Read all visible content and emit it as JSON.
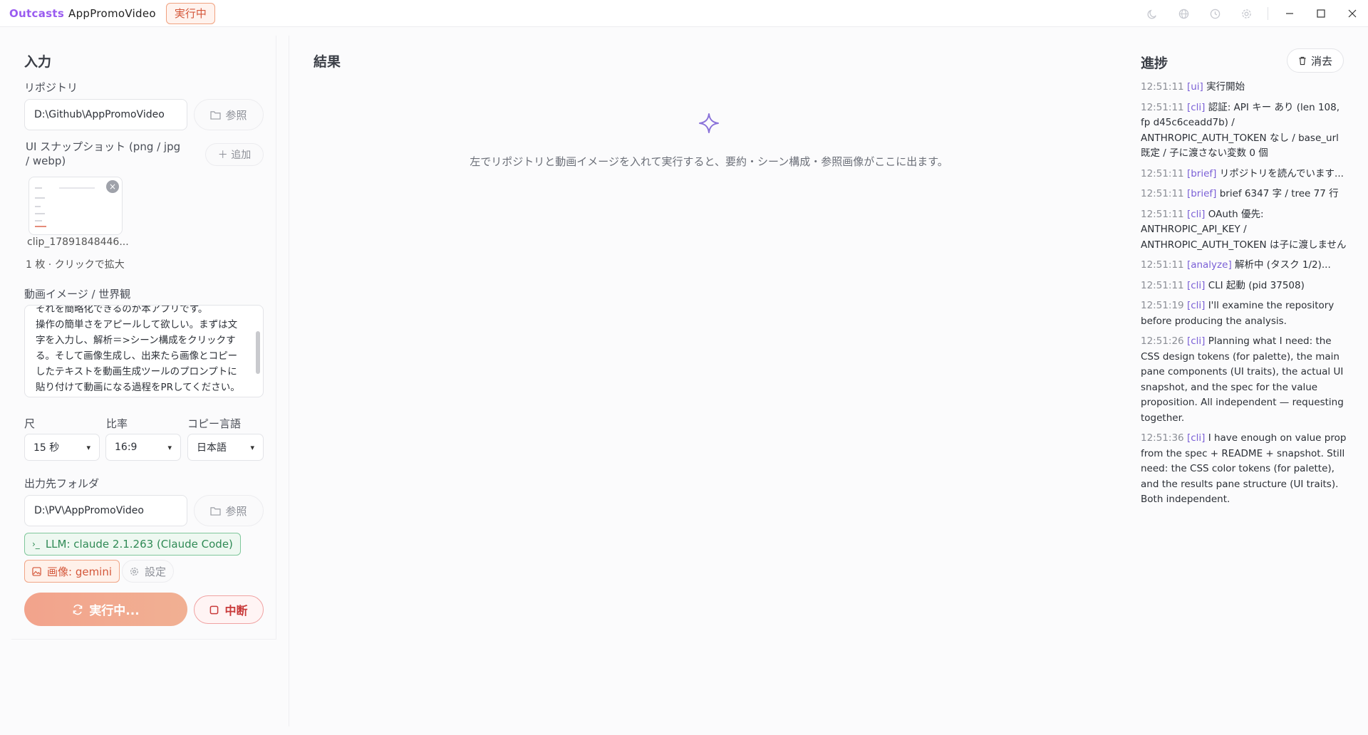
{
  "titlebar": {
    "brand": "Outcasts",
    "app_name": "AppPromoVideo",
    "status_badge": "実行中"
  },
  "input_panel": {
    "title": "入力",
    "repo_label": "リポジトリ",
    "repo_value": "D:\\Github\\AppPromoVideo",
    "browse_label": "参照",
    "snapshot_label": "UI スナップショット (png / jpg / webp)",
    "add_label": "＋ 追加",
    "snapshot_filename": "clip_17891848446...",
    "snapshot_caption": "1 枚 · クリックで拡大",
    "image_label": "動画イメージ / 世界観",
    "image_text_lines": [
      "それを簡略化できるのが本アプリです。",
      "操作の簡単さをアピールして欲しい。まずは文",
      "字を入力し、解析＝>シーン構成をクリックす",
      "る。そして画像生成し、出来たら画像とコピー",
      "したテキストを動画生成ツールのプロンプトに",
      "貼り付けて動画になる過程をPRしてください。"
    ],
    "length_label": "尺",
    "length_value": "15 秒",
    "ratio_label": "比率",
    "ratio_value": "16:9",
    "copy_lang_label": "コピー言語",
    "copy_lang_value": "日本語",
    "output_label": "出力先フォルダ",
    "output_value": "D:\\PV\\AppPromoVideo",
    "output_browse_label": "参照",
    "llm_badge": "LLM: claude 2.1.263 (Claude Code)",
    "image_badge": "画像: gemini",
    "settings_label": "設定",
    "run_label": "実行中...",
    "stop_label": "中断"
  },
  "result_panel": {
    "title": "結果",
    "empty_message": "左でリポジトリと動画イメージを入れて実行すると、要約・シーン構成・参照画像がここに出ます。"
  },
  "progress_panel": {
    "title": "進捗",
    "clear_label": "消去",
    "log": [
      {
        "time": "12:51:11",
        "tag": "[ui]",
        "text": "実行開始"
      },
      {
        "time": "12:51:11",
        "tag": "[cli]",
        "text": "認証: API キー あり (len 108, fp d45c6ceadd7b) / ANTHROPIC_AUTH_TOKEN なし / base_url 既定 / 子に渡さない変数 0 個"
      },
      {
        "time": "12:51:11",
        "tag": "[brief]",
        "text": "リポジトリを読んでいます..."
      },
      {
        "time": "12:51:11",
        "tag": "[brief]",
        "text": "brief 6347 字 / tree 77 行"
      },
      {
        "time": "12:51:11",
        "tag": "[cli]",
        "text": "OAuth 優先: ANTHROPIC_API_KEY / ANTHROPIC_AUTH_TOKEN は子に渡しません"
      },
      {
        "time": "12:51:11",
        "tag": "[analyze]",
        "text": "解析中 (タスク 1/2)..."
      },
      {
        "time": "12:51:11",
        "tag": "[cli]",
        "text": "CLI 起動 (pid 37508)"
      },
      {
        "time": "12:51:19",
        "tag": "[cli]",
        "text": "I'll examine the repository before producing the analysis."
      },
      {
        "time": "12:51:26",
        "tag": "[cli]",
        "text": "Planning what I need: the CSS design tokens (for palette), the main pane components (UI traits), the actual UI snapshot, and the spec for the value proposition. All independent — requesting together."
      },
      {
        "time": "12:51:36",
        "tag": "[cli]",
        "text": "I have enough on value prop from the spec + README + snapshot. Still need: the CSS color tokens (for palette), and the results pane structure (UI traits). Both independent."
      }
    ]
  },
  "icons": [
    "moon-icon",
    "globe-icon",
    "history-icon",
    "gear-icon",
    "minimize-icon",
    "maximize-icon",
    "close-icon",
    "folder-icon",
    "terminal-icon",
    "image-icon",
    "refresh-icon",
    "stop-icon",
    "sparkle-icon",
    "trash-icon"
  ]
}
